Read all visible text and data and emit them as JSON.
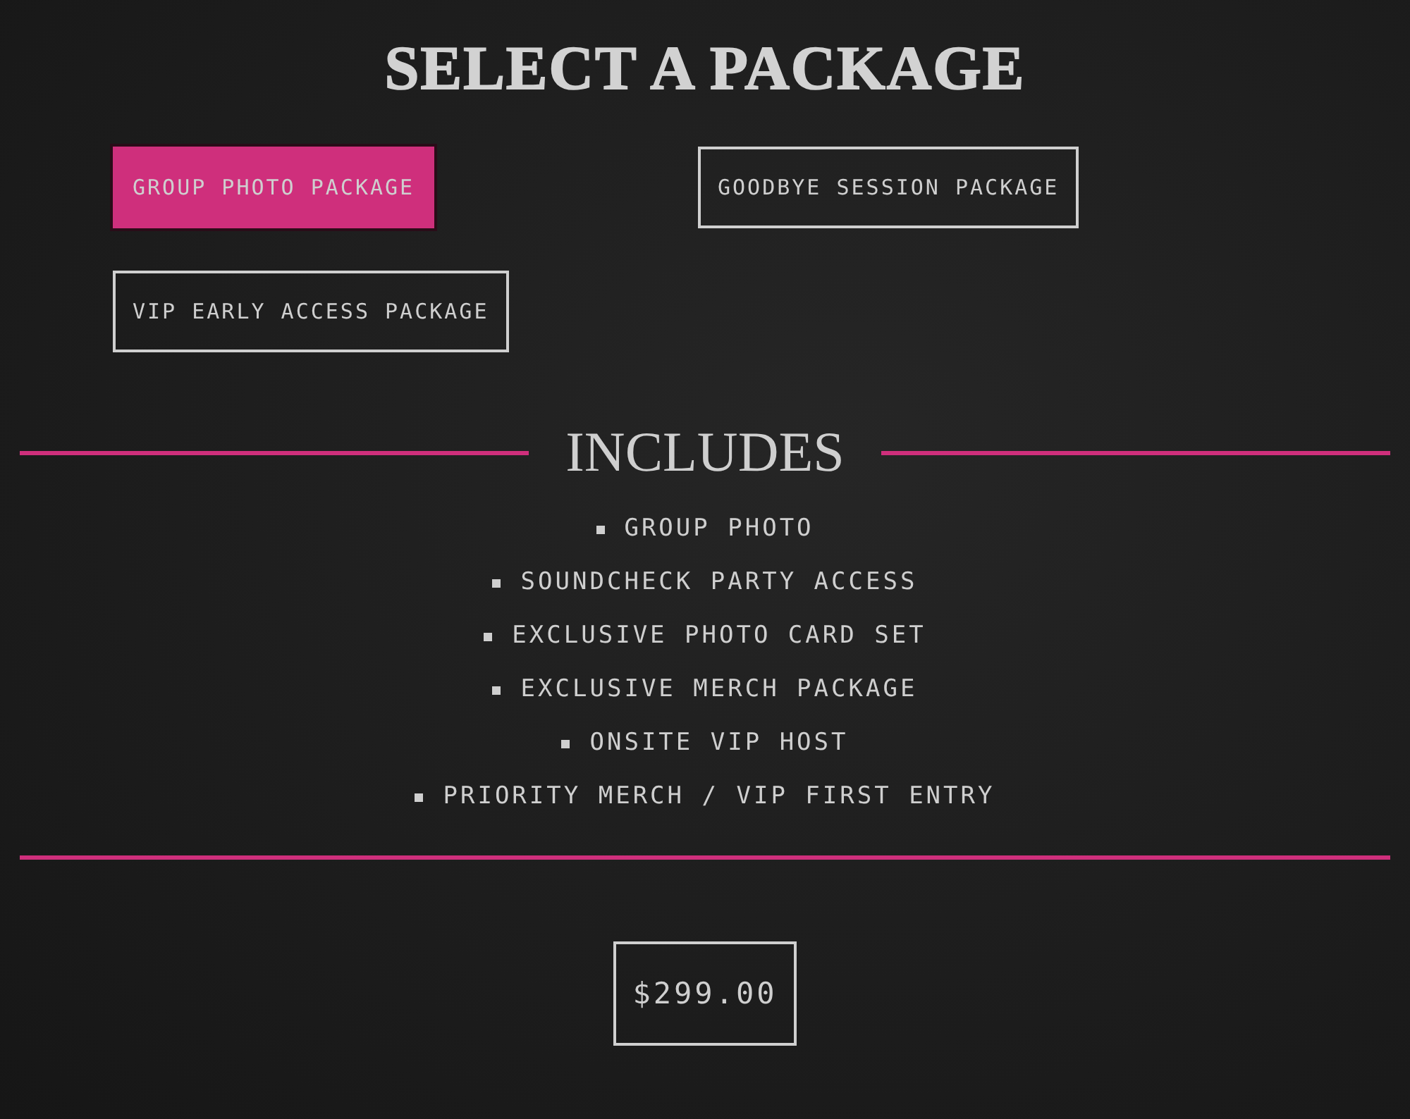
{
  "title": "SELECT A PACKAGE",
  "packages": [
    {
      "label": "GROUP PHOTO PACKAGE",
      "selected": true
    },
    {
      "label": "GOODBYE SESSION PACKAGE",
      "selected": false
    },
    {
      "label": "VIP EARLY ACCESS PACKAGE",
      "selected": false
    }
  ],
  "includes": {
    "heading": "INCLUDES",
    "items": [
      "GROUP PHOTO",
      "SOUNDCHECK PARTY ACCESS",
      "EXCLUSIVE PHOTO CARD SET",
      "EXCLUSIVE MERCH PACKAGE",
      "ONSITE VIP HOST",
      "PRIORITY MERCH / VIP FIRST ENTRY"
    ]
  },
  "price": "$299.00"
}
